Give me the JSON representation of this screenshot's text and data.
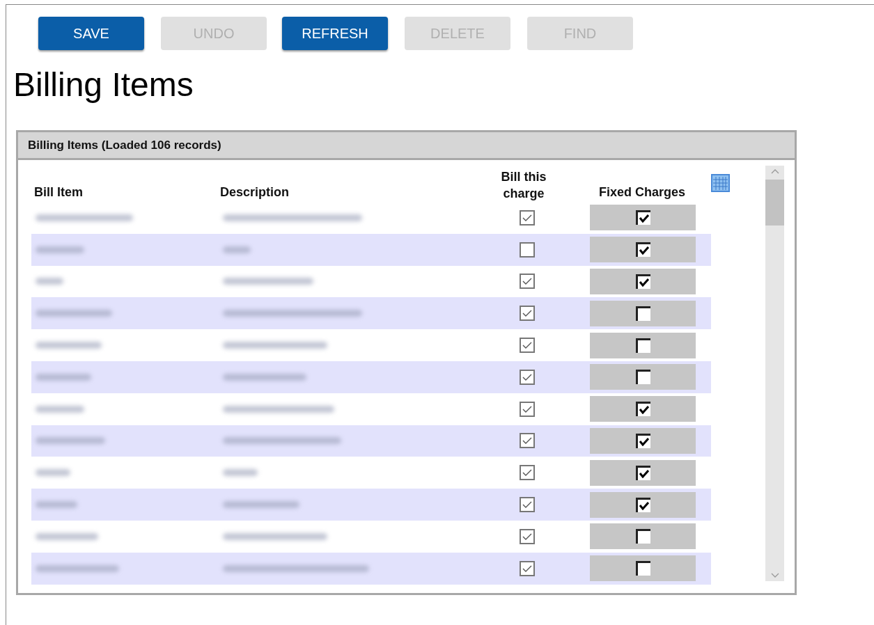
{
  "toolbar": [
    {
      "label": "SAVE",
      "disabled": false
    },
    {
      "label": "UNDO",
      "disabled": true
    },
    {
      "label": "REFRESH",
      "disabled": false
    },
    {
      "label": "DELETE",
      "disabled": true
    },
    {
      "label": "FIND",
      "disabled": true
    }
  ],
  "title": "Billing Items",
  "panel": {
    "title": "Billing Items (Loaded 106 records)",
    "columns": [
      "Bill Item",
      "Description",
      "Bill this charge",
      "Fixed Charges"
    ],
    "rows": [
      {
        "bill_this_charge": true,
        "fixed_charges": true
      },
      {
        "bill_this_charge": false,
        "fixed_charges": true
      },
      {
        "bill_this_charge": true,
        "fixed_charges": true
      },
      {
        "bill_this_charge": true,
        "fixed_charges": false
      },
      {
        "bill_this_charge": true,
        "fixed_charges": false
      },
      {
        "bill_this_charge": true,
        "fixed_charges": false
      },
      {
        "bill_this_charge": true,
        "fixed_charges": true
      },
      {
        "bill_this_charge": true,
        "fixed_charges": true
      },
      {
        "bill_this_charge": true,
        "fixed_charges": true
      },
      {
        "bill_this_charge": true,
        "fixed_charges": true
      },
      {
        "bill_this_charge": true,
        "fixed_charges": false
      },
      {
        "bill_this_charge": true,
        "fixed_charges": false
      }
    ]
  }
}
